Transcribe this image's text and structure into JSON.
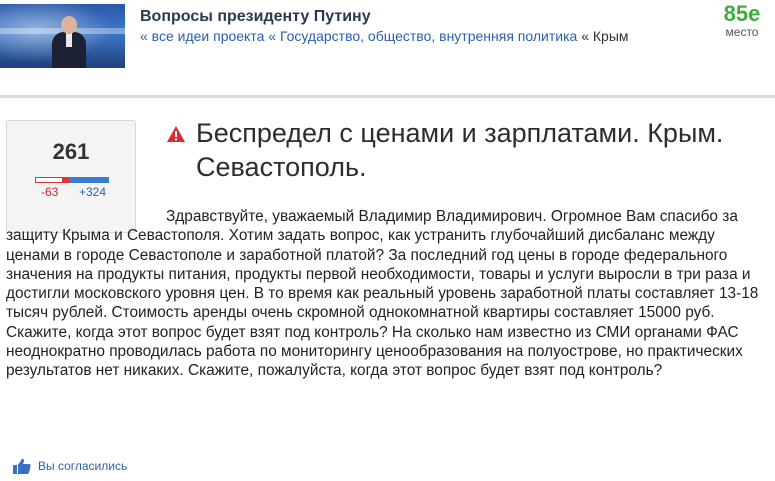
{
  "header": {
    "project_title": "Вопросы президенту Путину",
    "breadcrumb": [
      {
        "label": "« все идеи проекта"
      },
      {
        "label": "« Государство, общество, внутренняя политика"
      },
      {
        "label": "« Крым"
      }
    ],
    "rank": {
      "value": "85е",
      "label": "место"
    }
  },
  "vote": {
    "score": "261",
    "negative": "-63",
    "positive": "+324"
  },
  "idea": {
    "title": "Беспредел с ценами и зарплатами. Крым. Севастополь.",
    "body": "Здравствуйте, уважаемый Владимир Владимирович. Огромное Вам спасибо за защиту Крыма и Севастополя. Хотим задать вопрос, как устранить глубочайший дисбаланс между ценами в городе Севастополе и заработной платой? За последний год цены в городе федерального значения на продукты питания, продукты первой необходимости, товары и услуги выросли в три раза и достигли московского уровня цен. В то время как реальный уровень заработной платы составляет 13-18 тысяч рублей. Стоимость аренды очень скромной однокомнатной квартиры составляет 15000 руб. Скажите, когда этот вопрос будет взят под контроль? На сколько нам известно из СМИ органами ФАС неоднократно проводилась работа по мониторингу ценообразования на полуострове, но практических результатов нет никаких. Скажите, пожалуйста, когда этот вопрос будет взят под контроль?"
  },
  "agree": {
    "label": "Вы согласились",
    "icon": "thumbs-up-icon"
  },
  "colors": {
    "link": "#2a5fb0",
    "rank": "#3cae3c",
    "negative": "#c62828",
    "warning": "#d32f2f"
  }
}
